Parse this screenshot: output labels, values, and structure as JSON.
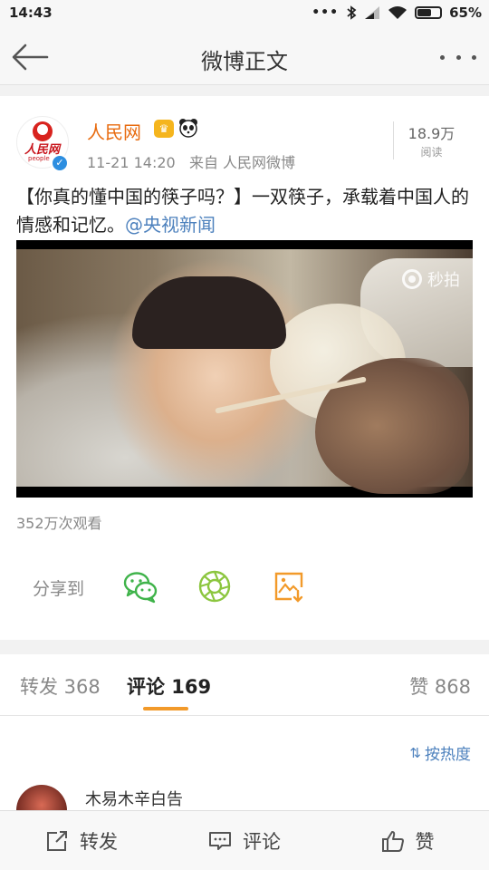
{
  "status_bar": {
    "time": "14:43",
    "signal_dots": "•••",
    "battery_percent_text": "65%",
    "battery_level": 0.65
  },
  "nav": {
    "title": "微博正文"
  },
  "post": {
    "author": "人民网",
    "avatar_logo_text": "人民网",
    "avatar_logo_sub": "people",
    "time": "11-21 14:20",
    "source": "来自 人民网微博",
    "read_count": "18.9万",
    "read_label": "阅读",
    "text": "【你真的懂中国的筷子吗？】一双筷子，承载着中国人的情感和记忆。",
    "mention": "@央视新闻",
    "video_brand": "秒拍",
    "play_count": "352万次观看",
    "share_label": "分享到"
  },
  "tabs": {
    "repost": "转发 368",
    "comment": "评论 169",
    "like": "赞 868"
  },
  "comments": {
    "sort_label": "按热度",
    "first_name": "木易木辛白告"
  },
  "toolbar": {
    "repost": "转发",
    "comment": "评论",
    "like": "赞"
  },
  "colors": {
    "author": "#e86b0f",
    "mention": "#4d81bd",
    "active_tab_underline": "#f29a2a",
    "wechat_green": "#3fb34a",
    "moments_green": "#8cc63f",
    "save_orange": "#f29a2a"
  },
  "icons": [
    "back-arrow-icon",
    "more-icon",
    "crown-icon",
    "panda-icon",
    "verified-icon",
    "wechat-icon",
    "moments-icon",
    "save-image-icon",
    "sort-icon",
    "repost-icon",
    "comment-icon",
    "like-icon"
  ]
}
